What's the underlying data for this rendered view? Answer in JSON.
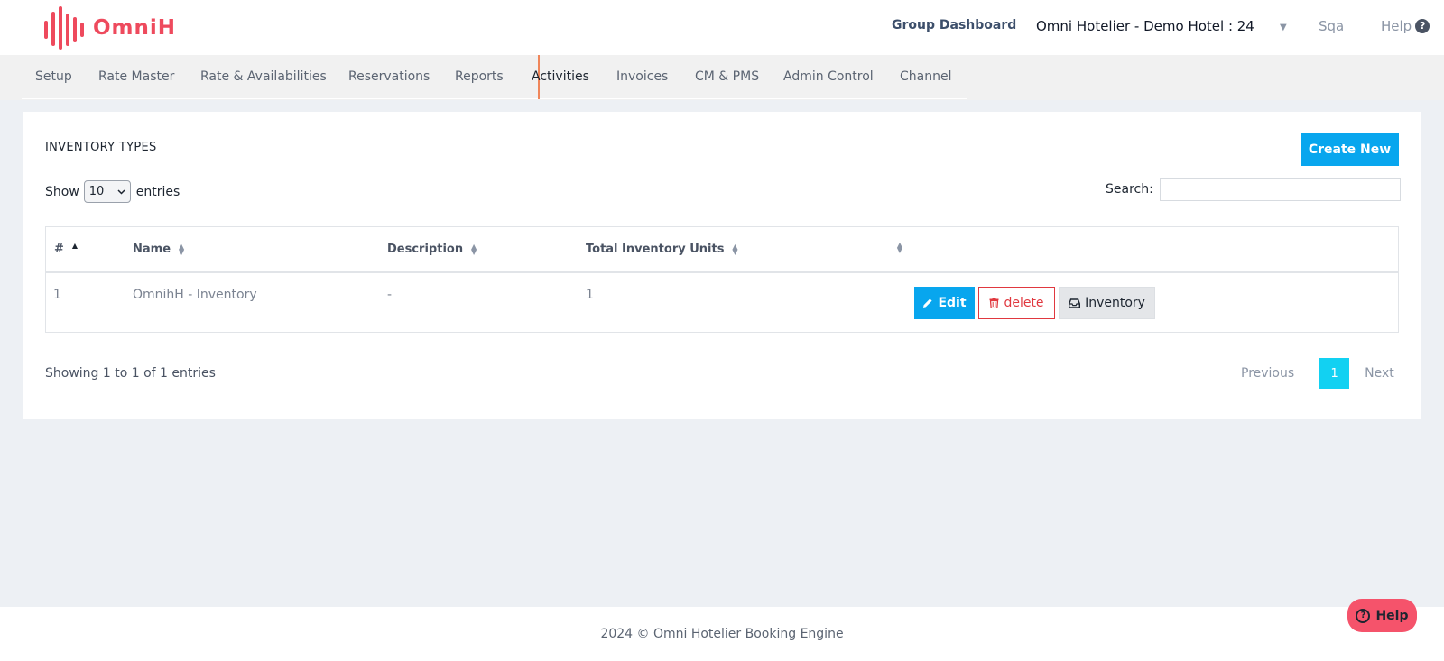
{
  "header": {
    "brand": "OmniH",
    "group_dashboard": "Group Dashboard",
    "hotel": "Omni Hotelier - Demo Hotel : 24",
    "user": "Sqa",
    "help": "Help"
  },
  "nav": {
    "items": [
      {
        "label": "Setup"
      },
      {
        "label": "Rate Master"
      },
      {
        "label": "Rate & Availabilities"
      },
      {
        "label": "Reservations"
      },
      {
        "label": "Reports"
      },
      {
        "label": "Activities"
      },
      {
        "label": "Invoices"
      },
      {
        "label": "CM & PMS"
      },
      {
        "label": "Admin Control"
      },
      {
        "label": "Channel"
      }
    ],
    "active": "Activities"
  },
  "card": {
    "title": "INVENTORY TYPES",
    "create_label": "Create New",
    "show_label": "Show",
    "entries_value": "10",
    "entries_label": "entries",
    "search_label": "Search:",
    "search_value": ""
  },
  "table": {
    "columns": [
      "#",
      "Name",
      "Description",
      "Total Inventory Units",
      ""
    ],
    "rows": [
      {
        "num": "1",
        "name": "OmnihH - Inventory",
        "description": "-",
        "units": "1"
      }
    ],
    "actions": {
      "edit": "Edit",
      "delete": "delete",
      "inventory": "Inventory"
    }
  },
  "pagination": {
    "summary": "Showing 1 to 1 of 1 entries",
    "previous": "Previous",
    "current": "1",
    "next": "Next"
  },
  "footer": {
    "text": "2024 © Omni Hotelier Booking Engine",
    "help_button": "Help"
  },
  "colors": {
    "brand": "#ee4a5d",
    "primary": "#08a6ee",
    "danger": "#e0383f",
    "active_page": "#12d1f2",
    "nav_active_marker": "#f0865a"
  }
}
